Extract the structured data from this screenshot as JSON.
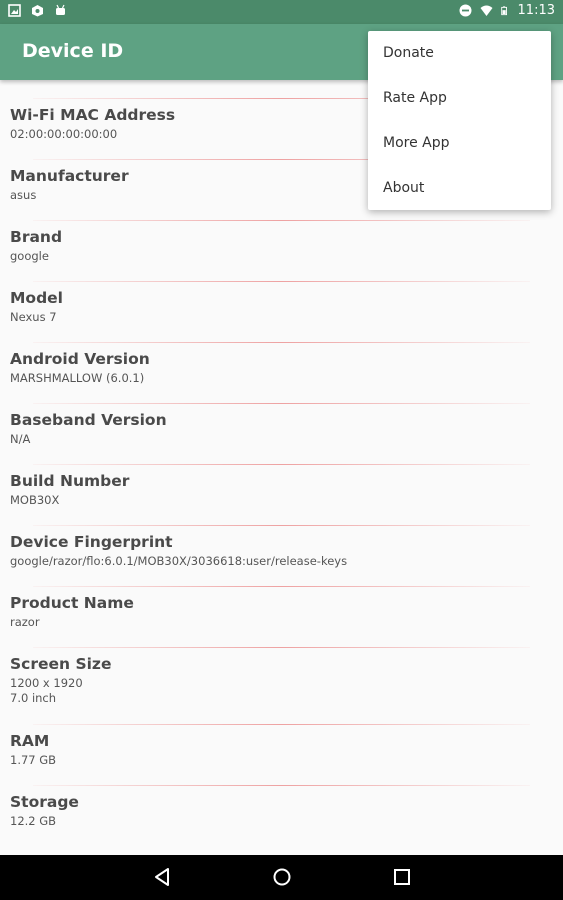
{
  "status_bar": {
    "time": "11:13"
  },
  "app_bar": {
    "title": "Device ID"
  },
  "menu": {
    "items": [
      {
        "label": "Donate"
      },
      {
        "label": "Rate App"
      },
      {
        "label": "More App"
      },
      {
        "label": "About"
      }
    ]
  },
  "info": [
    {
      "label": "Wi-Fi MAC Address",
      "value": "02:00:00:00:00:00"
    },
    {
      "label": "Manufacturer",
      "value": "asus"
    },
    {
      "label": "Brand",
      "value": "google"
    },
    {
      "label": "Model",
      "value": "Nexus 7"
    },
    {
      "label": "Android Version",
      "value": "MARSHMALLOW (6.0.1)"
    },
    {
      "label": "Baseband Version",
      "value": "N/A"
    },
    {
      "label": "Build Number",
      "value": "MOB30X"
    },
    {
      "label": "Device Fingerprint",
      "value": "google/razor/flo:6.0.1/MOB30X/3036618:user/release-keys"
    },
    {
      "label": "Product Name",
      "value": "razor"
    },
    {
      "label": "Screen Size",
      "value": "1200 x 1920\n7.0 inch"
    },
    {
      "label": "RAM",
      "value": "1.77 GB"
    },
    {
      "label": "Storage",
      "value": "12.2 GB"
    }
  ]
}
